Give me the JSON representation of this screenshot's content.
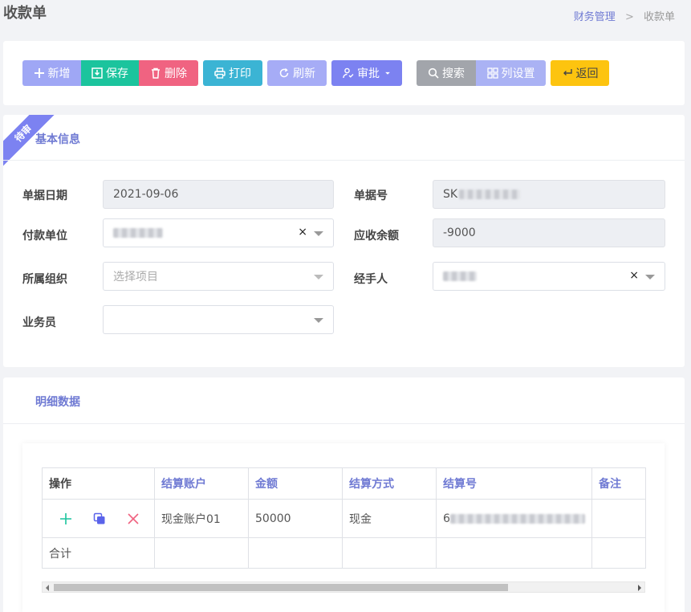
{
  "page": {
    "title": "收款单"
  },
  "breadcrumb": {
    "parent": "财务管理",
    "separator": ">",
    "current": "收款单"
  },
  "toolbar": {
    "add": "新增",
    "save": "保存",
    "delete": "删除",
    "print": "打印",
    "refresh": "刷新",
    "approve": "审批",
    "search": "搜索",
    "columns": "列设置",
    "back": "返回"
  },
  "basic": {
    "ribbon": "待审",
    "title": "基本信息",
    "fields": {
      "date_label": "单据日期",
      "date_value": "2021-09-06",
      "number_label": "单据号",
      "number_value": "SK",
      "payer_label": "付款单位",
      "balance_label": "应收余额",
      "balance_value": "-9000",
      "org_label": "所属组织",
      "org_placeholder": "选择项目",
      "handler_label": "经手人",
      "sales_label": "业务员"
    }
  },
  "detail": {
    "title": "明细数据",
    "columns": [
      "操作",
      "结算账户",
      "金额",
      "结算方式",
      "结算号",
      "备注"
    ],
    "rows": [
      {
        "account": "现金账户01",
        "amount": "50000",
        "method": "现金",
        "number": "6",
        "note": ""
      }
    ],
    "total_label": "合计"
  },
  "colors": {
    "accent": "#7c82f1",
    "success": "#1bc49d",
    "danger": "#f06381",
    "info": "#3bb4d4",
    "warning": "#fdc40f"
  }
}
